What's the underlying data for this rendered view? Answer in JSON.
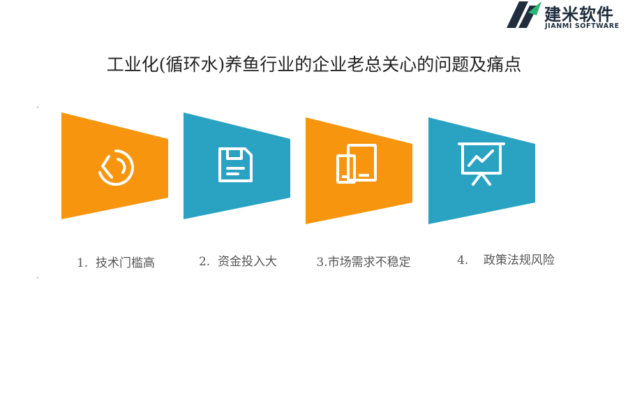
{
  "logo": {
    "name_cn": "建米软件",
    "name_en": "JIANMI SOFTWARE",
    "colors": {
      "dark": "#1f2d3d",
      "green": "#2bb673"
    }
  },
  "title": "工业化(循环水)养鱼行业的企业老总关心的问题及痛点",
  "colors": {
    "orange": "#f7950f",
    "teal": "#2aa2c1",
    "icon": "#ffffff",
    "label": "#555555"
  },
  "items": [
    {
      "label": "1.  技术门槛高",
      "color": "orange",
      "icon": "pie-chart-icon"
    },
    {
      "label": "2.  资金投入大",
      "color": "teal",
      "icon": "save-icon"
    },
    {
      "label": "3.市场需求不稳定",
      "color": "orange",
      "icon": "devices-icon"
    },
    {
      "label": "4.    政策法规风险",
      "color": "teal",
      "icon": "presentation-chart-icon"
    }
  ]
}
